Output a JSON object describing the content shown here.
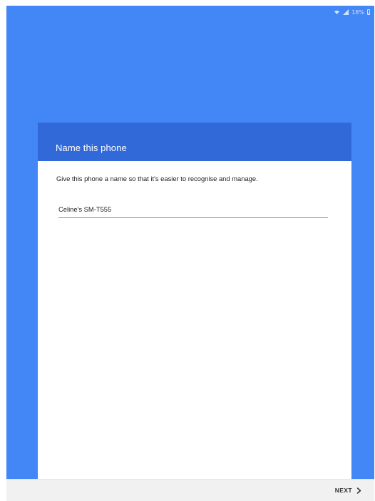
{
  "status_bar": {
    "battery_text": "18%",
    "icons": [
      "wifi-icon",
      "signal-icon",
      "battery-icon"
    ]
  },
  "dialog": {
    "title": "Name this phone",
    "description": "Give this phone a name so that it's easier to recognise and manage.",
    "device_name_value": "Celine's SM-T555"
  },
  "footer": {
    "next_label": "NEXT",
    "next_icon": "chevron-right-icon"
  },
  "colors": {
    "background_blue": "#4287f5",
    "header_blue": "#3169d8",
    "card_background": "#ffffff",
    "footer_background": "#f1f1f1"
  }
}
